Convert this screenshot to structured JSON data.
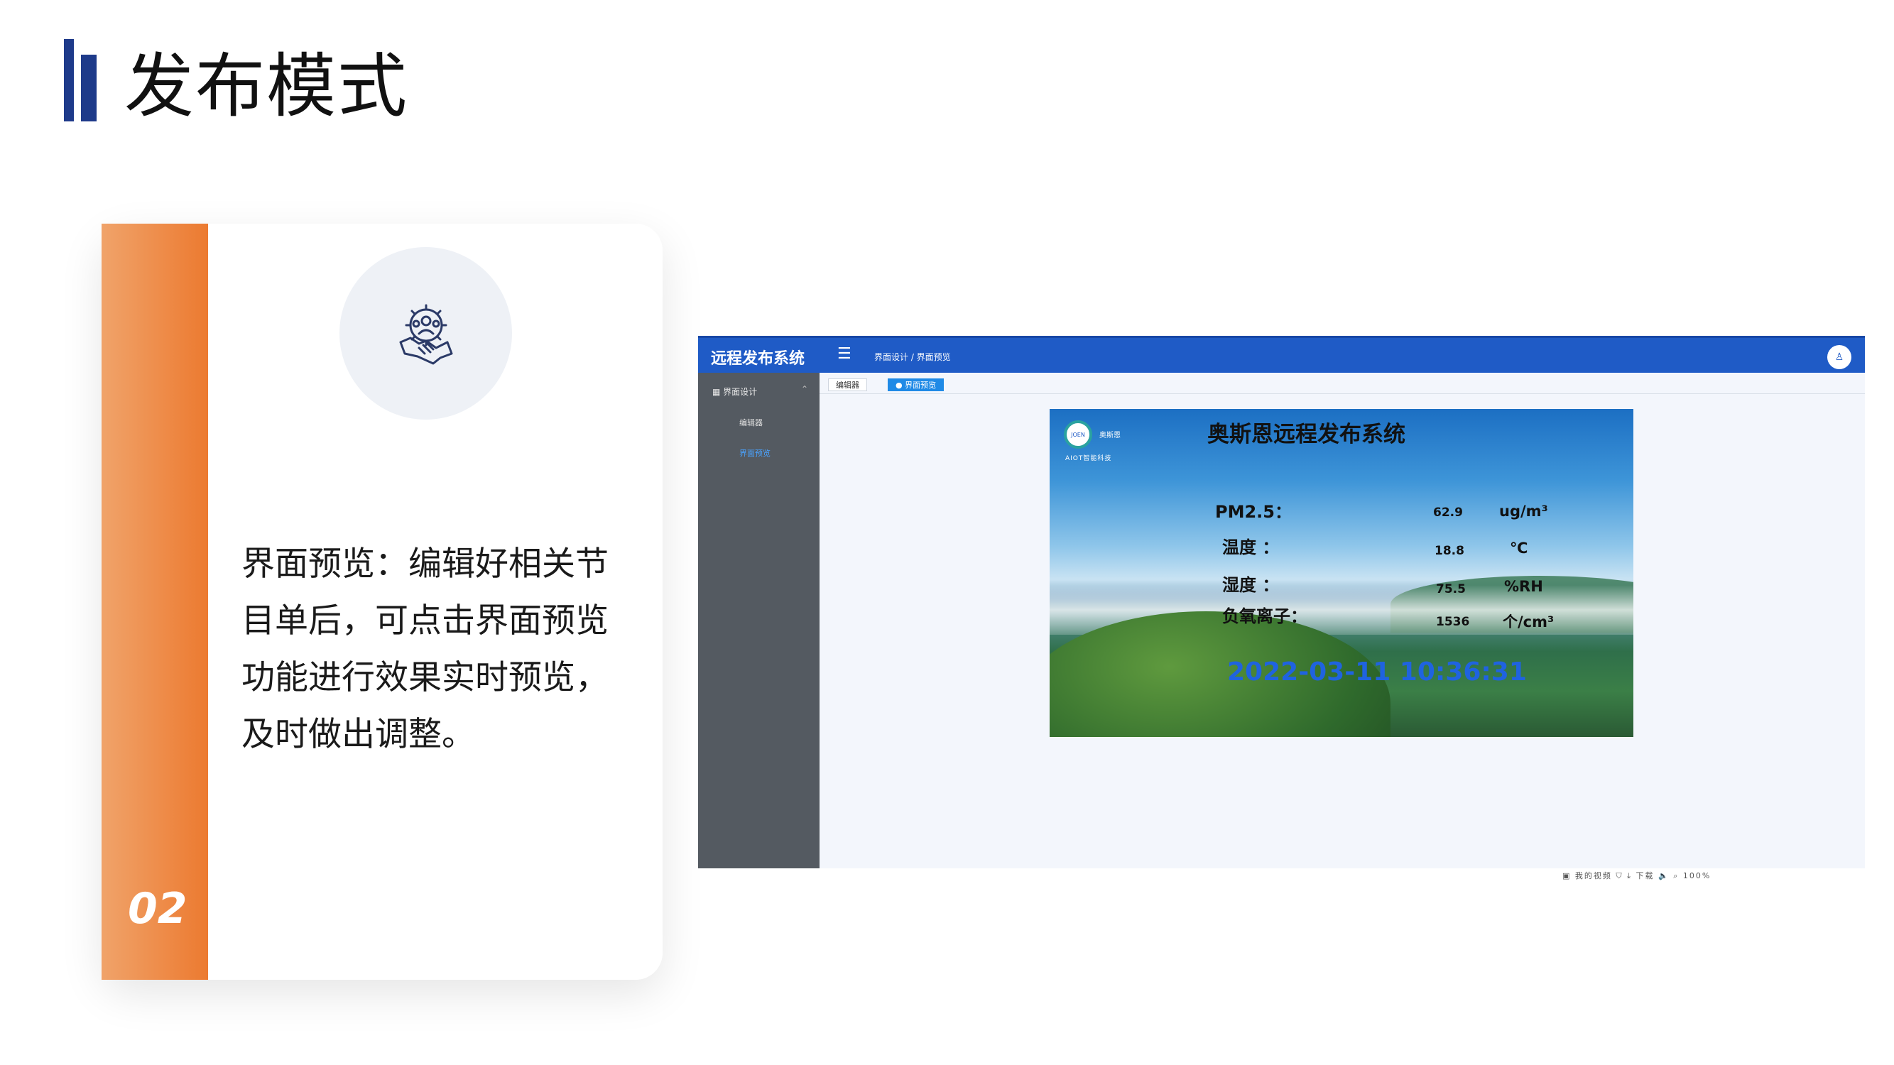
{
  "page": {
    "title": "发布模式"
  },
  "card": {
    "number": "02",
    "icon": "teamwork-handshake-gear-icon",
    "description": "界面预览：编辑好相关节目单后，可点击界面预览功能进行效果实时预览，及时做出调整。"
  },
  "app": {
    "name": "远程发布系统",
    "breadcrumb": "界面设计  /  界面预览",
    "sidebar": {
      "group": "界面设计",
      "items": [
        "编辑器",
        "界面预览"
      ]
    },
    "tabs": [
      "编辑器",
      "界面预览"
    ]
  },
  "preview": {
    "logo_text": "JOEN",
    "logo_name": "奥斯恩",
    "logo_sub": "AIOT智能科技",
    "title": "奥斯恩远程发布系统",
    "metrics": [
      {
        "label": "PM2.5：",
        "value": "62.9",
        "unit": "ug/m³"
      },
      {
        "label": "温度  ：",
        "value": "18.8",
        "unit": "℃"
      },
      {
        "label": "湿度  ：",
        "value": "75.5",
        "unit": "%RH"
      },
      {
        "label": "负氧离子：",
        "value": "1536",
        "unit": "个/cm³"
      }
    ],
    "datetime": "2022-03-11 10:36:31"
  },
  "statusbar": {
    "label": "我的视频",
    "download": "下载",
    "zoom": "100%"
  },
  "colors": {
    "title_bar": "#1e3a8a",
    "accent_orange": "#ec7a30",
    "app_header": "#1f5bc6",
    "sidebar": "#545a61",
    "clock": "#1f63e0"
  }
}
